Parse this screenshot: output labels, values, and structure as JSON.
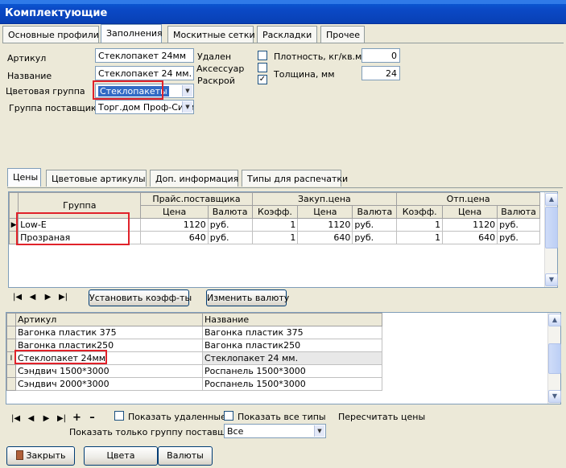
{
  "window": {
    "title": "Комплектующие"
  },
  "tabs": [
    "Основные профили",
    "Заполнения",
    "Москитные сетки",
    "Раскладки",
    "Прочее"
  ],
  "form": {
    "article_label": "Артикул",
    "article_value": "Стеклопакет 24мм",
    "name_label": "Название",
    "name_value": "Стеклопакет 24 мм.",
    "color_group_label": "Цветовая группа",
    "color_group_value": "Стеклопакеты",
    "supplier_group_label": "Группа поставщика",
    "supplier_group_value": "Торг.дом Проф-Сити",
    "deleted_label": "Удален",
    "accessory_label": "Аксессуар",
    "cutting_label": "Раскрой",
    "density_label": "Плотность, кг/кв.м.",
    "density_value": "0",
    "thickness_label": "Толщина, мм",
    "thickness_value": "24"
  },
  "subtabs": [
    "Цены",
    "Цветовые артикулы",
    "Доп. информация",
    "Типы для распечатки"
  ],
  "price_grid": {
    "group_header": "Группа",
    "pricelist_header": "Прайс.поставщика",
    "purchase_header": "Закуп.цена",
    "sale_header": "Отп.цена",
    "sub_headers": [
      "Цена",
      "Валюта",
      "Коэфф.",
      "Цена",
      "Валюта",
      "Коэфф.",
      "Цена",
      "Валюта"
    ],
    "rows": [
      [
        "Low-E",
        "1120",
        "руб.",
        "1",
        "1120",
        "руб.",
        "1",
        "1120",
        "руб."
      ],
      [
        "Прозраная",
        "640",
        "руб.",
        "1",
        "640",
        "руб.",
        "1",
        "640",
        "руб."
      ]
    ]
  },
  "price_buttons": {
    "set_coeff": "Установить коэфф-ты",
    "change_currency": "Изменить валюту"
  },
  "list_grid": {
    "headers": [
      "Артикул",
      "Название"
    ],
    "rows": [
      [
        "Вагонка пластик 375",
        "Вагонка пластик 375"
      ],
      [
        "Вагонка пластик250",
        "Вагонка пластик250"
      ],
      [
        "Стеклопакет 24мм",
        "Стеклопакет 24 мм."
      ],
      [
        "Сэндвич 1500*3000",
        "Роспанель 1500*3000"
      ],
      [
        "Сэндвич 2000*3000",
        "Роспанель 1500*3000"
      ]
    ]
  },
  "bottom": {
    "show_deleted": "Показать удаленные",
    "show_all_types": "Показать все типы",
    "recalc_prices": "Пересчитать цены",
    "only_supplier_label": "Показать только группу поставщика",
    "only_supplier_value": "Все"
  },
  "footer_buttons": {
    "close": "Закрыть",
    "colors": "Цвета",
    "currencies": "Валюты"
  }
}
